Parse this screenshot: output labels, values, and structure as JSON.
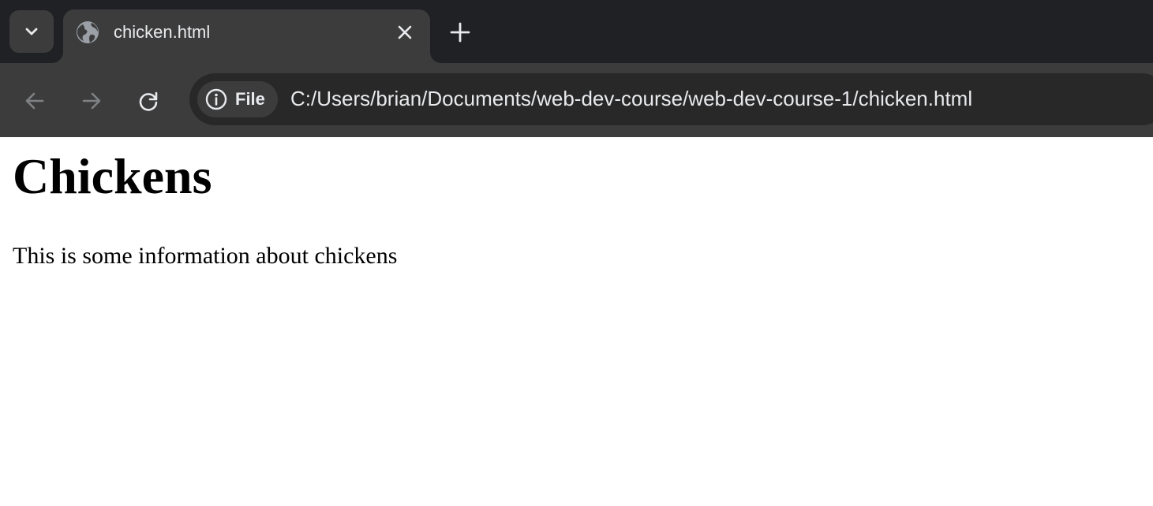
{
  "browser": {
    "tab": {
      "title": "chicken.html",
      "favicon": "globe-icon"
    },
    "address_bar": {
      "chip_label": "File",
      "url": "C:/Users/brian/Documents/web-dev-course/web-dev-course-1/chicken.html"
    },
    "icons": {
      "tab_search": "chevron-down-icon",
      "close_tab": "close-icon",
      "new_tab": "plus-icon",
      "back": "arrow-left-icon",
      "forward": "arrow-right-icon",
      "reload": "reload-icon",
      "site_info": "info-icon"
    },
    "colors": {
      "tabstrip": "#202124",
      "toolbar": "#3c3c3c",
      "omnibox": "#282828",
      "text": "#e8eaed"
    }
  },
  "page": {
    "heading": "Chickens",
    "paragraph": "This is some information about chickens"
  }
}
